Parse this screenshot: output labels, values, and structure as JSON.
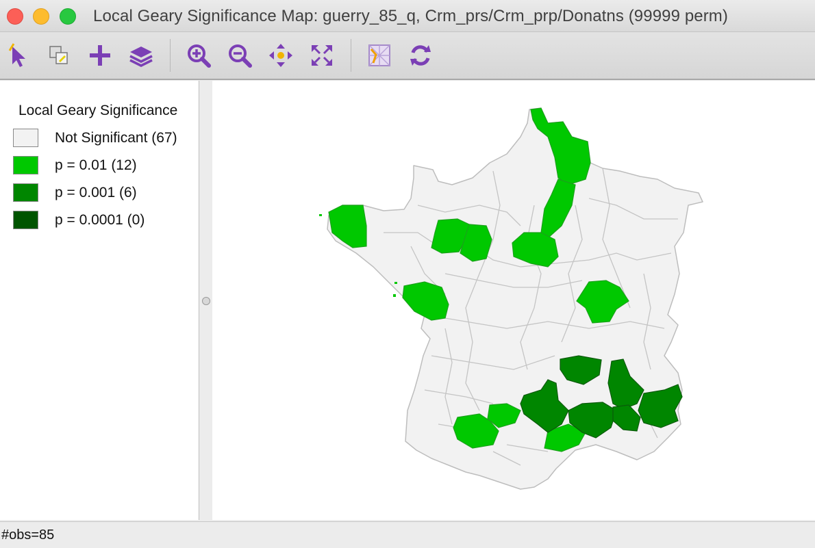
{
  "window": {
    "title": "Local Geary Significance Map: guerry_85_q, Crm_prs/Crm_prp/Donatns (99999 perm)"
  },
  "toolbar": {
    "tools": [
      {
        "name": "select-tool",
        "icon": "select-arrow-icon"
      },
      {
        "name": "selection-mode-tool",
        "icon": "selection-shape-icon"
      },
      {
        "name": "add-tool",
        "icon": "plus-icon"
      },
      {
        "name": "layers-tool",
        "icon": "layers-icon"
      },
      {
        "name": "zoom-in-tool",
        "icon": "zoom-in-icon"
      },
      {
        "name": "zoom-out-tool",
        "icon": "zoom-out-icon"
      },
      {
        "name": "pan-tool",
        "icon": "pan-arrows-icon"
      },
      {
        "name": "full-extent-tool",
        "icon": "full-extent-icon"
      },
      {
        "name": "basemap-tool",
        "icon": "basemap-icon"
      },
      {
        "name": "refresh-tool",
        "icon": "refresh-icon"
      }
    ],
    "accent_color": "#7b3fb5"
  },
  "legend": {
    "title": "Local Geary Significance",
    "items": [
      {
        "label": "Not Significant (67)",
        "color": "#f2f2f2"
      },
      {
        "label": "p = 0.01 (12)",
        "color": "#00c800"
      },
      {
        "label": "p = 0.001 (6)",
        "color": "#008600"
      },
      {
        "label": "p = 0.0001 (0)",
        "color": "#005400"
      }
    ]
  },
  "status": {
    "text": "#obs=85"
  }
}
